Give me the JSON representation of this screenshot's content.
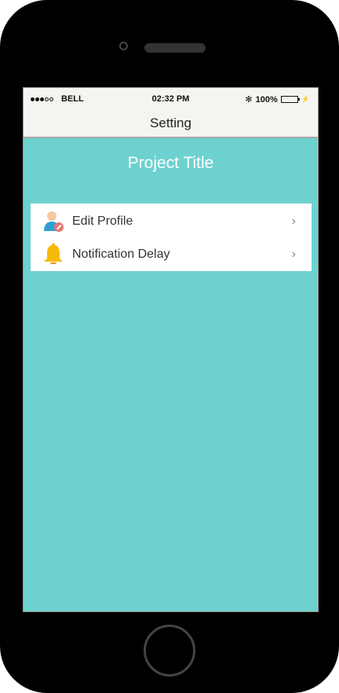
{
  "status_bar": {
    "carrier": "BELL",
    "time": "02:32 PM",
    "bluetooth": "✻",
    "battery": "100%",
    "signal_dots_filled": 3,
    "signal_dots_total": 5
  },
  "nav": {
    "title": "Setting"
  },
  "main": {
    "project_title": "Project Title",
    "menu": [
      {
        "label": "Edit Profile",
        "icon": "edit-profile-icon",
        "chevron": "›"
      },
      {
        "label": "Notification Delay",
        "icon": "bell-icon",
        "chevron": "›"
      }
    ]
  },
  "colors": {
    "screen_bg": "#6dd2cf",
    "bar_bg": "#f5f4f0",
    "bell": "#f9b90a",
    "avatar_body": "#2f9fd3",
    "avatar_skin": "#f6c89f",
    "edit_badge": "#e57373"
  }
}
